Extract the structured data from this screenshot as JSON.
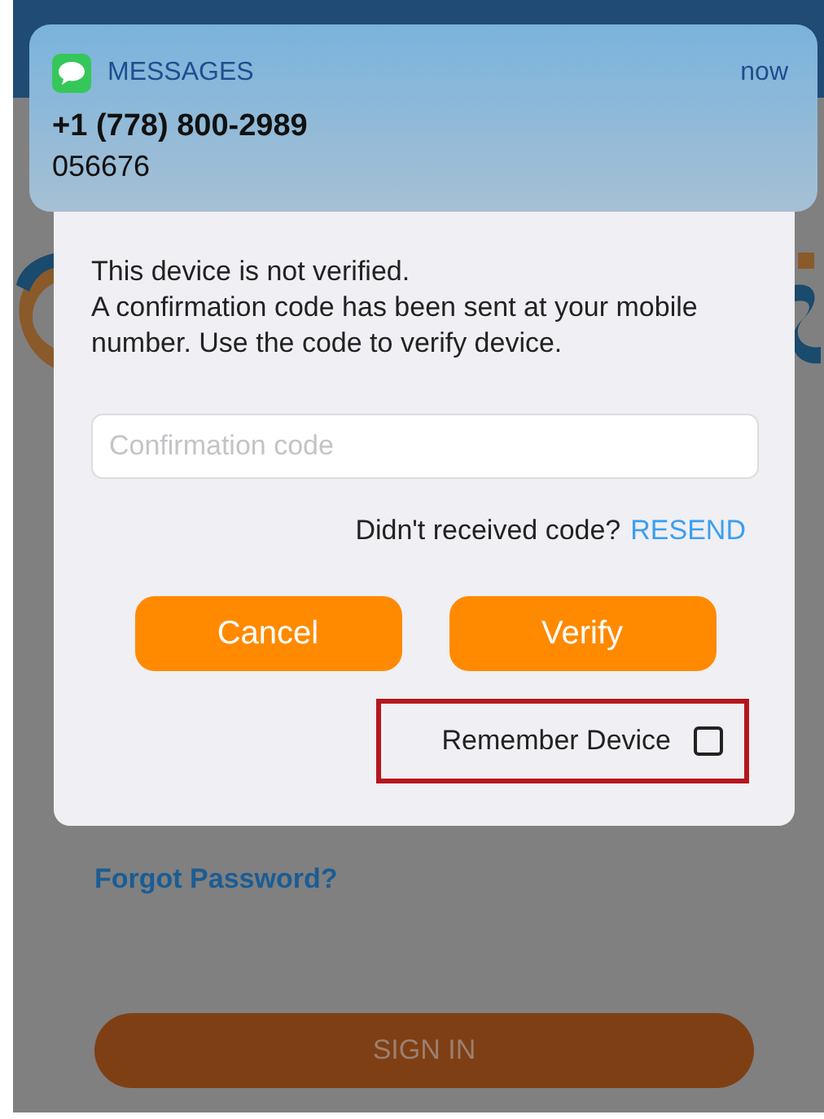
{
  "notification": {
    "app": "MESSAGES",
    "time": "now",
    "sender": "+1 (778) 800-2989",
    "body": "056676"
  },
  "dialog": {
    "message_lines": [
      "This device is not verified.",
      "A confirmation code has been sent at your mobile number. Use the code to verify device."
    ],
    "code_field": {
      "placeholder": "Confirmation code"
    },
    "resend_prompt": "Didn't received code?",
    "resend_link": "RESEND",
    "buttons": [
      "Cancel",
      "Verify"
    ],
    "remember_device": {
      "label": "Remember Device",
      "checked": false
    }
  },
  "background": {
    "forgot_password": "Forgot Password?",
    "sign_in": "SIGN IN"
  }
}
